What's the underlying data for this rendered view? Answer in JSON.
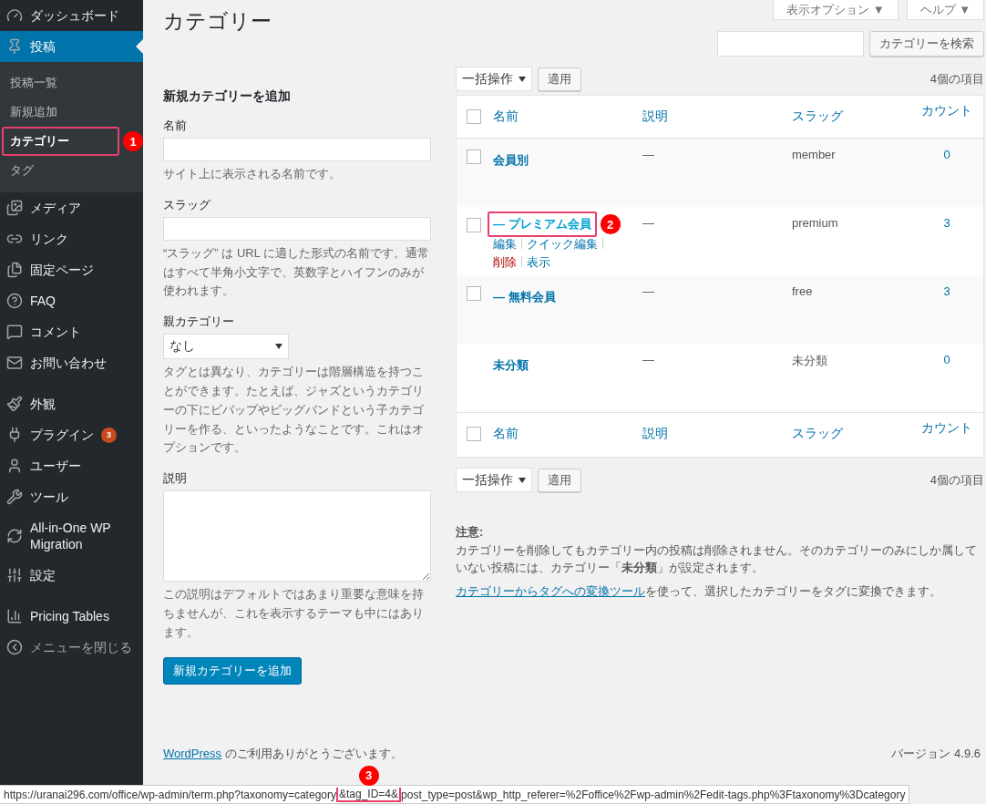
{
  "sidebar": {
    "menu_groups": [
      [
        {
          "label": "ダッシュボード",
          "current": false
        },
        {
          "label": "投稿",
          "current": true,
          "submenu": [
            {
              "label": "投稿一覧",
              "selected": false
            },
            {
              "label": "新規追加",
              "selected": false
            },
            {
              "label": "カテゴリー",
              "selected": true,
              "annotation": "1"
            },
            {
              "label": "タグ",
              "selected": false
            }
          ]
        },
        {
          "label": "メディア",
          "current": false
        },
        {
          "label": "リンク",
          "current": false
        },
        {
          "label": "固定ページ",
          "current": false
        },
        {
          "label": "FAQ",
          "current": false
        },
        {
          "label": "コメント",
          "current": false
        },
        {
          "label": "お問い合わせ",
          "current": false
        }
      ],
      [
        {
          "label": "外観",
          "current": false
        },
        {
          "label": "プラグイン",
          "current": false,
          "badge": "3"
        },
        {
          "label": "ユーザー",
          "current": false
        },
        {
          "label": "ツール",
          "current": false
        },
        {
          "label": "All-in-One WP Migration",
          "current": false
        },
        {
          "label": "設定",
          "current": false
        }
      ],
      [
        {
          "label": "Pricing Tables",
          "current": false
        },
        {
          "label": "メニューを閉じる",
          "current": false,
          "kind": "collapse"
        }
      ]
    ]
  },
  "screen_meta": [
    "表示オプション ▼",
    "ヘルプ ▼"
  ],
  "page_title": "カテゴリー",
  "add_form": {
    "heading": "新規カテゴリーを追加",
    "fields": [
      {
        "kind": "text",
        "label": "名前",
        "help": "サイト上に表示される名前です。"
      },
      {
        "kind": "text",
        "label": "スラッグ",
        "help": "“スラッグ” は URL に適した形式の名前です。通常はすべて半角小文字で、英数字とハイフンのみが使われます。"
      },
      {
        "kind": "select",
        "label": "親カテゴリー",
        "value": "なし",
        "help": "タグとは異なり、カテゴリーは階層構造を持つことができます。たとえば、ジャズというカテゴリーの下にビバップやビッグバンドという子カテゴリーを作る、といったようなことです。これはオプションです。"
      },
      {
        "kind": "textarea",
        "label": "説明",
        "help": "この説明はデフォルトではあまり重要な意味を持ちませんが、これを表示するテーマも中にはあります。"
      }
    ],
    "submit": "新規カテゴリーを追加"
  },
  "search": {
    "button": "カテゴリーを検索"
  },
  "bulk_actions": {
    "select": "一括操作",
    "apply": "適用",
    "count": "4個の項目"
  },
  "table": {
    "select_all_checked": false,
    "columns": [
      {
        "label": "名前"
      },
      {
        "label": "説明"
      },
      {
        "label": "スラッグ"
      },
      {
        "label": "カウント"
      }
    ],
    "footer_select_all_checked": false,
    "footer_columns": [
      {
        "label": "名前"
      },
      {
        "label": "説明"
      },
      {
        "label": "スラッグ"
      },
      {
        "label": "カウント"
      }
    ],
    "rows": [
      {
        "name": "会員別",
        "description": "—",
        "slug": "member",
        "count": "0",
        "checkbox": true,
        "checked": false
      },
      {
        "name": "— プレミアム会員",
        "description": "—",
        "slug": "premium",
        "count": "3",
        "checkbox": true,
        "checked": false,
        "annotation": "2",
        "actions": [
          {
            "label": "編集",
            "kind": "link"
          },
          {
            "label": "クイック編集",
            "kind": "link"
          },
          {
            "label": "削除",
            "kind": "delete"
          },
          {
            "label": "表示",
            "kind": "link"
          }
        ]
      },
      {
        "name": "— 無料会員",
        "description": "—",
        "slug": "free",
        "count": "3",
        "checkbox": true,
        "checked": false
      },
      {
        "name": "未分類",
        "description": "—",
        "slug": "未分類",
        "count": "0",
        "checkbox": false
      }
    ]
  },
  "bulk_actions_bottom": {
    "select": "一括操作",
    "apply": "適用",
    "count": "4個の項目"
  },
  "notice": {
    "heading": "注意:",
    "text": "カテゴリーを削除してもカテゴリー内の投稿は削除されません。そのカテゴリーのみにしか属していない投稿には、カテゴリー「**未分類**」が設定されます。",
    "link": "カテゴリーからタグへの変換ツール",
    "link_suffix": "を使って、選択したカテゴリーをタグに変換できます。"
  },
  "footer": {
    "link": "WordPress",
    "text": " のご利用ありがとうございます。",
    "version": "バージョン 4.9.6"
  },
  "status_bar": {
    "url_before": "https://uranai296.com/office/wp-admin/term.php?taxonomy=category",
    "url_highlight": "&tag_ID=4&",
    "url_after": "post_type=post&wp_http_referer=%2Foffice%2Fwp-admin%2Fedit-tags.php%3Ftaxonomy%3Dcategory",
    "annotation": "3"
  }
}
